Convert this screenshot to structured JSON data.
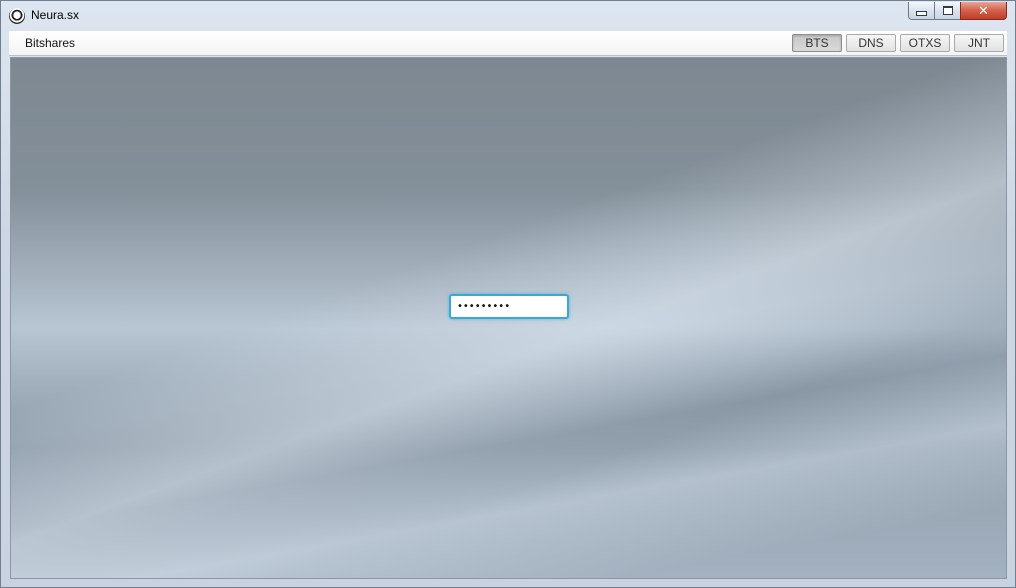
{
  "window": {
    "title": "Neura.sx",
    "app_icon": "neura-logo-icon",
    "controls": {
      "minimize": "minimize-icon",
      "maximize": "maximize-icon",
      "close_label": "✕"
    }
  },
  "menubar": {
    "menu_label": "Bitshares",
    "tabs": [
      {
        "label": "BTS",
        "active": true
      },
      {
        "label": "DNS",
        "active": false
      },
      {
        "label": "OTXS",
        "active": false
      },
      {
        "label": "JNT",
        "active": false
      }
    ]
  },
  "login": {
    "password_value": "•••••••••"
  },
  "colors": {
    "focus_border": "#39a8d8",
    "close_button": "#c13d25",
    "background": "#8d9ba8"
  }
}
